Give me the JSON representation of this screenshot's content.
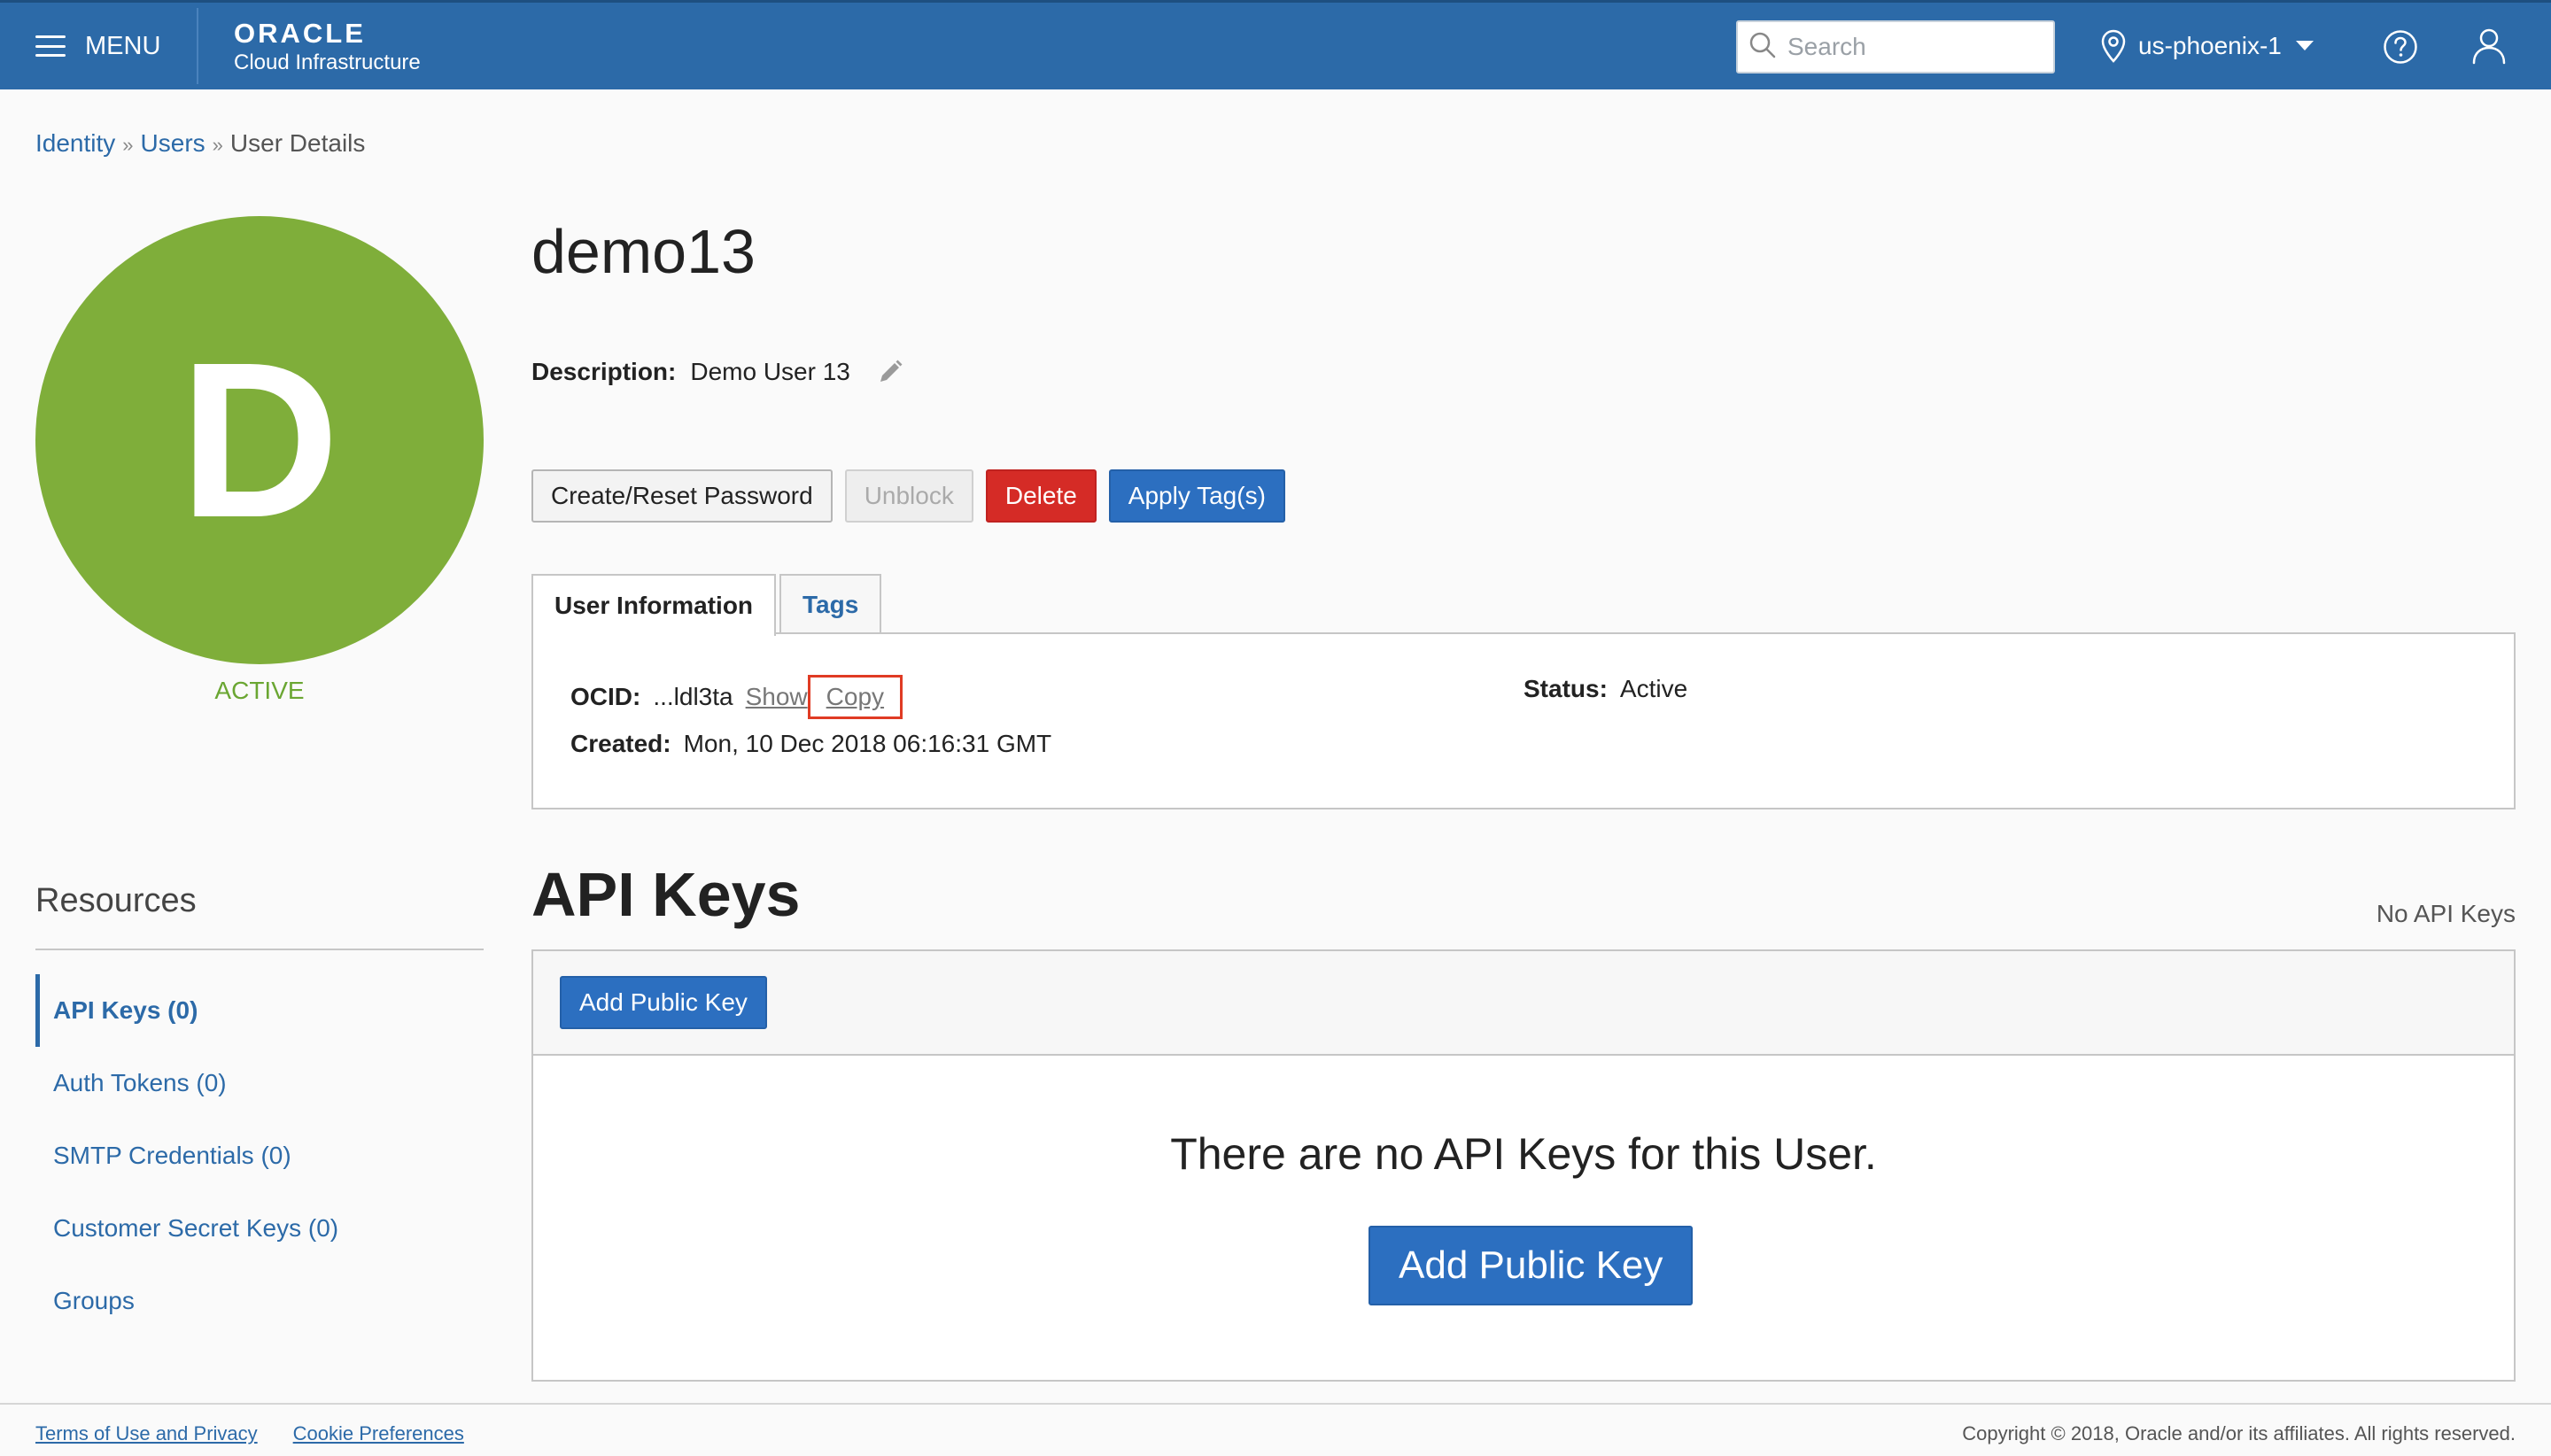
{
  "header": {
    "menu_label": "MENU",
    "brand_logo": "ORACLE",
    "brand_sub": "Cloud Infrastructure",
    "search_placeholder": "Search",
    "region": "us-phoenix-1"
  },
  "breadcrumb": {
    "items": [
      "Identity",
      "Users"
    ],
    "separator": "»",
    "current": "User Details"
  },
  "user": {
    "avatar_letter": "D",
    "avatar_color": "#7fae3a",
    "status": "ACTIVE",
    "name": "demo13",
    "description_label": "Description:",
    "description": "Demo User 13"
  },
  "actions": {
    "create_reset": "Create/Reset Password",
    "unblock": "Unblock",
    "delete": "Delete",
    "apply_tags": "Apply Tag(s)"
  },
  "tabs": {
    "user_info": "User Information",
    "tags": "Tags"
  },
  "info": {
    "ocid_label": "OCID:",
    "ocid_value": "...ldl3ta",
    "show": "Show",
    "copy": "Copy",
    "created_label": "Created:",
    "created_value": "Mon, 10 Dec 2018 06:16:31 GMT",
    "status_label": "Status:",
    "status_value": "Active"
  },
  "resources": {
    "title": "Resources",
    "items": [
      "API Keys (0)",
      "Auth Tokens (0)",
      "SMTP Credentials (0)",
      "Customer Secret Keys (0)",
      "Groups"
    ]
  },
  "api_keys": {
    "title": "API Keys",
    "count_text": "No API Keys",
    "add_button": "Add Public Key",
    "empty_message": "There are no API Keys for this User.",
    "empty_add_button": "Add Public Key"
  },
  "footer": {
    "terms": "Terms of Use and Privacy",
    "cookies": "Cookie Preferences",
    "copyright": "Copyright © 2018, Oracle and/or its affiliates. All rights reserved."
  },
  "colors": {
    "header_bg": "#2c6aa8",
    "accent": "#2c6fc0",
    "danger": "#d52b26",
    "active_green": "#6aa632",
    "highlight": "#e03b24"
  }
}
